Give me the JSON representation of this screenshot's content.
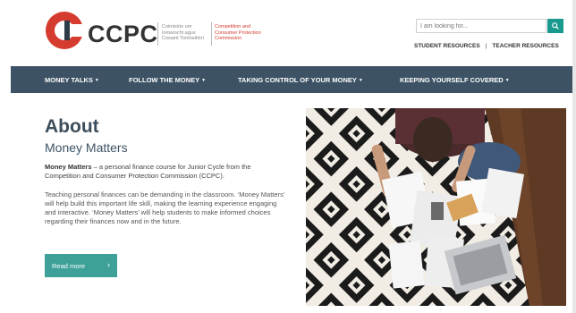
{
  "header": {
    "brand": "CCPC",
    "subtitle_irish": "Coimisiún um\nIomaíocht agus\nCosaint Tomhaltóirí",
    "subtitle_english": "Competition and\nConsumer Protection\nCommission",
    "search_placeholder": "I am looking for...",
    "student_resources": "STUDENT RESOURCES",
    "separator": "|",
    "teacher_resources": "TEACHER RESOURCES"
  },
  "nav": {
    "items": [
      {
        "label": "MONEY TALKS"
      },
      {
        "label": "FOLLOW THE MONEY"
      },
      {
        "label": "TAKING CONTROL OF YOUR MONEY"
      },
      {
        "label": "KEEPING YOURSELF COVERED"
      }
    ]
  },
  "main": {
    "title": "About",
    "subtitle": "Money Matters",
    "para1_bold": "Money Matters",
    "para1_rest": " – a personal finance course for Junior Cycle from the Competition and Consumer Protection Commission (CCPC).",
    "para2": "Teaching personal finances can be demanding in the classroom. ‘Money Matters’ will help build this important life skill, making the learning experience engaging and interactive. ‘Money Matters’ will help students to make informed choices regarding their finances now and in the future.",
    "read_more": "Read more",
    "read_more_arrow": "›"
  },
  "colors": {
    "accent_red": "#d63b2f",
    "nav_bg": "#3d5365",
    "teal": "#1a9a8f",
    "button_teal": "#3da19a"
  },
  "icons": {
    "search": "search-icon",
    "caret": "chevron-down-icon",
    "arrow": "chevron-right-icon"
  }
}
